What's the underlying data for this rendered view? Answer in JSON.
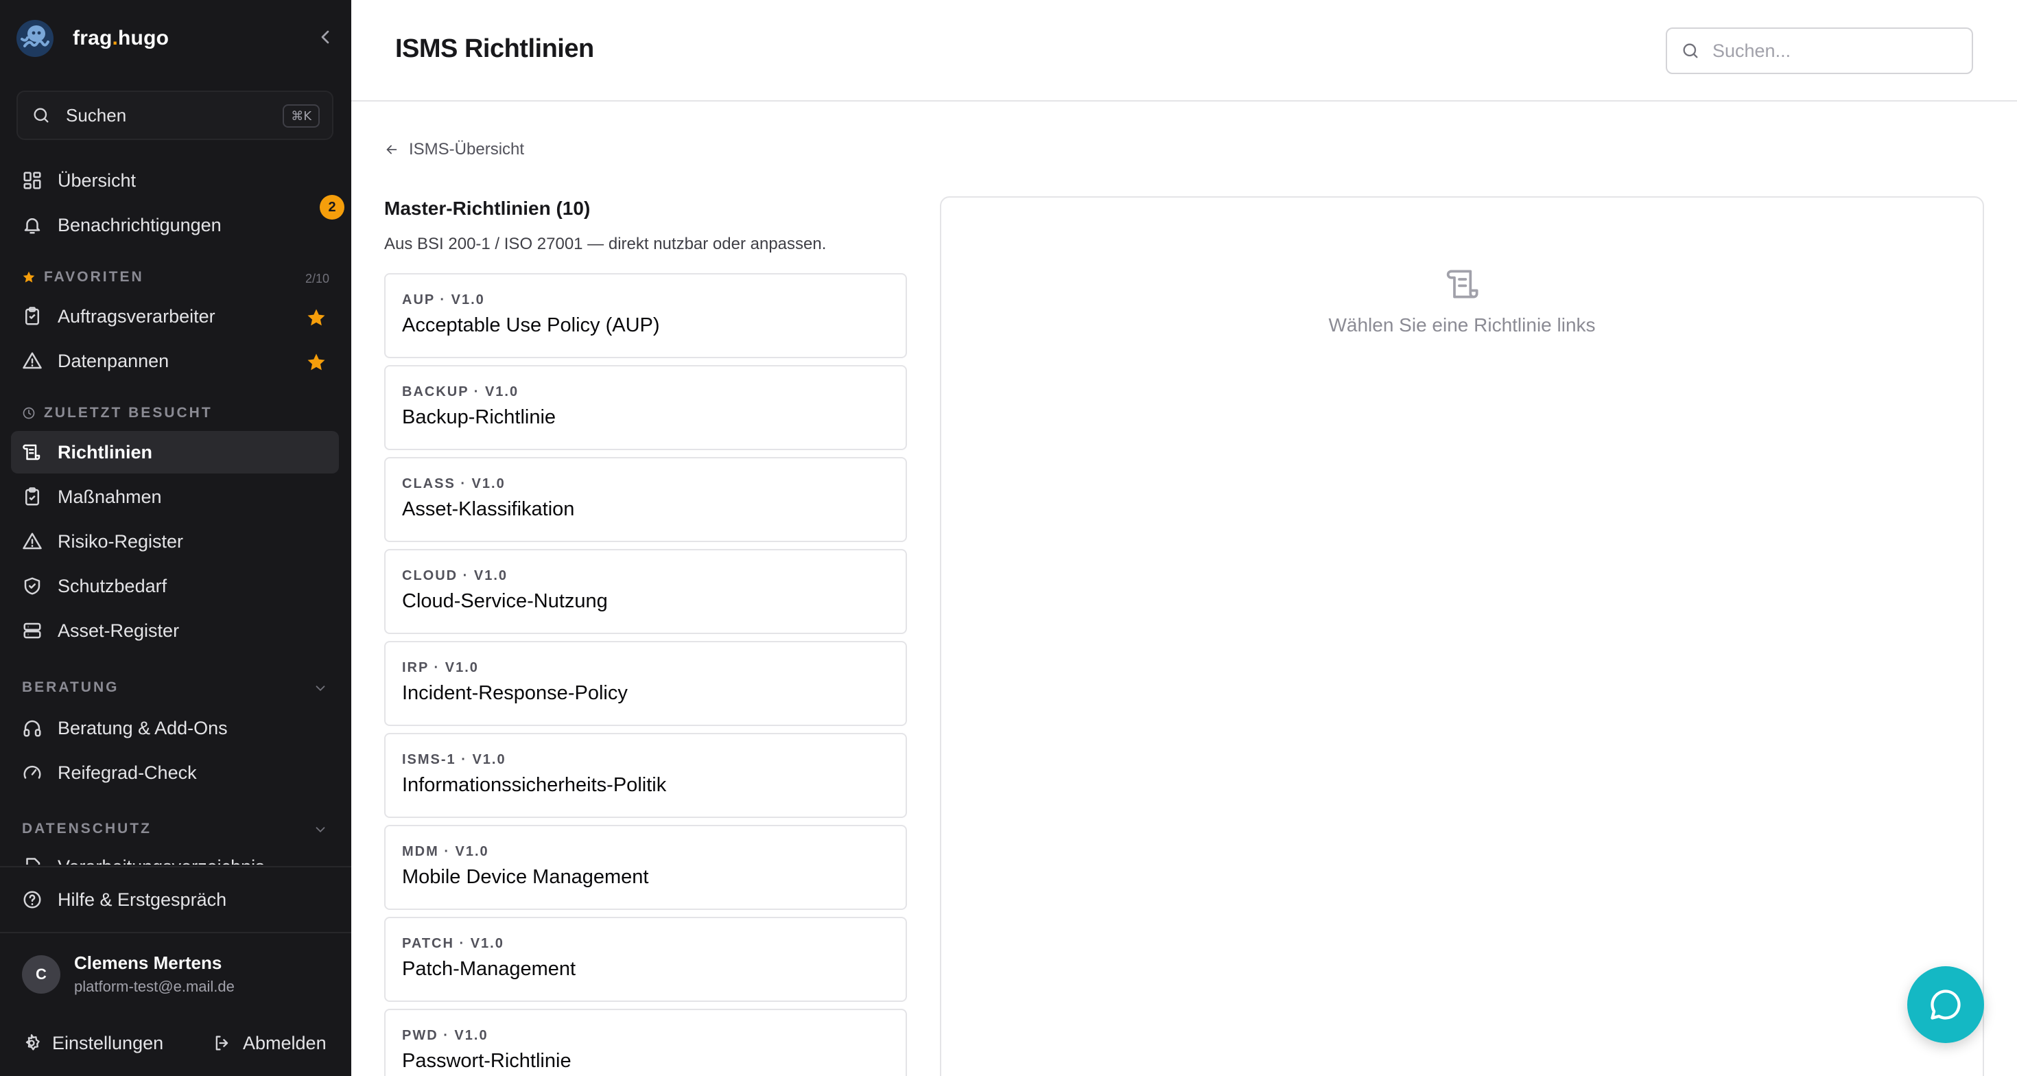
{
  "brand": {
    "name_a": "frag",
    "dot": ".",
    "name_b": "hugo"
  },
  "sidebar": {
    "search": {
      "label": "Suchen",
      "shortcut": "⌘K"
    },
    "main_items": [
      {
        "label": "Übersicht",
        "icon": "dashboard-icon"
      },
      {
        "label": "Benachrichtigungen",
        "icon": "bell-icon",
        "badge": "2"
      }
    ],
    "favorites": {
      "title": "FAVORITEN",
      "count": "2/10",
      "items": [
        {
          "label": "Auftragsverarbeiter",
          "icon": "clipboard-icon"
        },
        {
          "label": "Datenpannen",
          "icon": "warning-icon"
        }
      ]
    },
    "recent": {
      "title": "ZULETZT BESUCHT",
      "items": [
        {
          "label": "Richtlinien",
          "icon": "scroll-icon",
          "active": true
        },
        {
          "label": "Maßnahmen",
          "icon": "clipboard-check-icon"
        },
        {
          "label": "Risiko-Register",
          "icon": "warning-icon"
        },
        {
          "label": "Schutzbedarf",
          "icon": "shield-icon"
        },
        {
          "label": "Asset-Register",
          "icon": "server-icon"
        }
      ]
    },
    "beratung": {
      "title": "BERATUNG",
      "items": [
        {
          "label": "Beratung & Add-Ons",
          "icon": "headphones-icon"
        },
        {
          "label": "Reifegrad-Check",
          "icon": "gauge-icon"
        }
      ]
    },
    "datenschutz": {
      "title": "DATENSCHUTZ",
      "cutoff_item": "Verarbeitungsverzeichnis"
    },
    "help": {
      "label": "Hilfe & Erstgespräch"
    },
    "user": {
      "initial": "C",
      "name": "Clemens Mertens",
      "email": "platform-test@e.mail.de"
    },
    "settings_label": "Einstellungen",
    "logout_label": "Abmelden"
  },
  "header": {
    "title": "ISMS Richtlinien",
    "search_placeholder": "Suchen..."
  },
  "content": {
    "back_label": "ISMS-Übersicht",
    "list_title": "Master-Richtlinien (10)",
    "list_subtitle": "Aus BSI 200-1 / ISO 27001 — direkt nutzbar oder anpassen.",
    "policies": [
      {
        "meta": "AUP · V1.0",
        "title": "Acceptable Use Policy (AUP)"
      },
      {
        "meta": "BACKUP · V1.0",
        "title": "Backup-Richtlinie"
      },
      {
        "meta": "CLASS · V1.0",
        "title": "Asset-Klassifikation"
      },
      {
        "meta": "CLOUD · V1.0",
        "title": "Cloud-Service-Nutzung"
      },
      {
        "meta": "IRP · V1.0",
        "title": "Incident-Response-Policy"
      },
      {
        "meta": "ISMS-1 · V1.0",
        "title": "Informationssicherheits-Politik"
      },
      {
        "meta": "MDM · V1.0",
        "title": "Mobile Device Management"
      },
      {
        "meta": "PATCH · V1.0",
        "title": "Patch-Management"
      },
      {
        "meta": "PWD · V1.0",
        "title": "Passwort-Richtlinie"
      }
    ],
    "empty_state": "Wählen Sie eine Richtlinie links"
  },
  "colors": {
    "sidebar_bg": "#18181b",
    "accent": "#f59e0b",
    "chat": "#14b8c4"
  }
}
